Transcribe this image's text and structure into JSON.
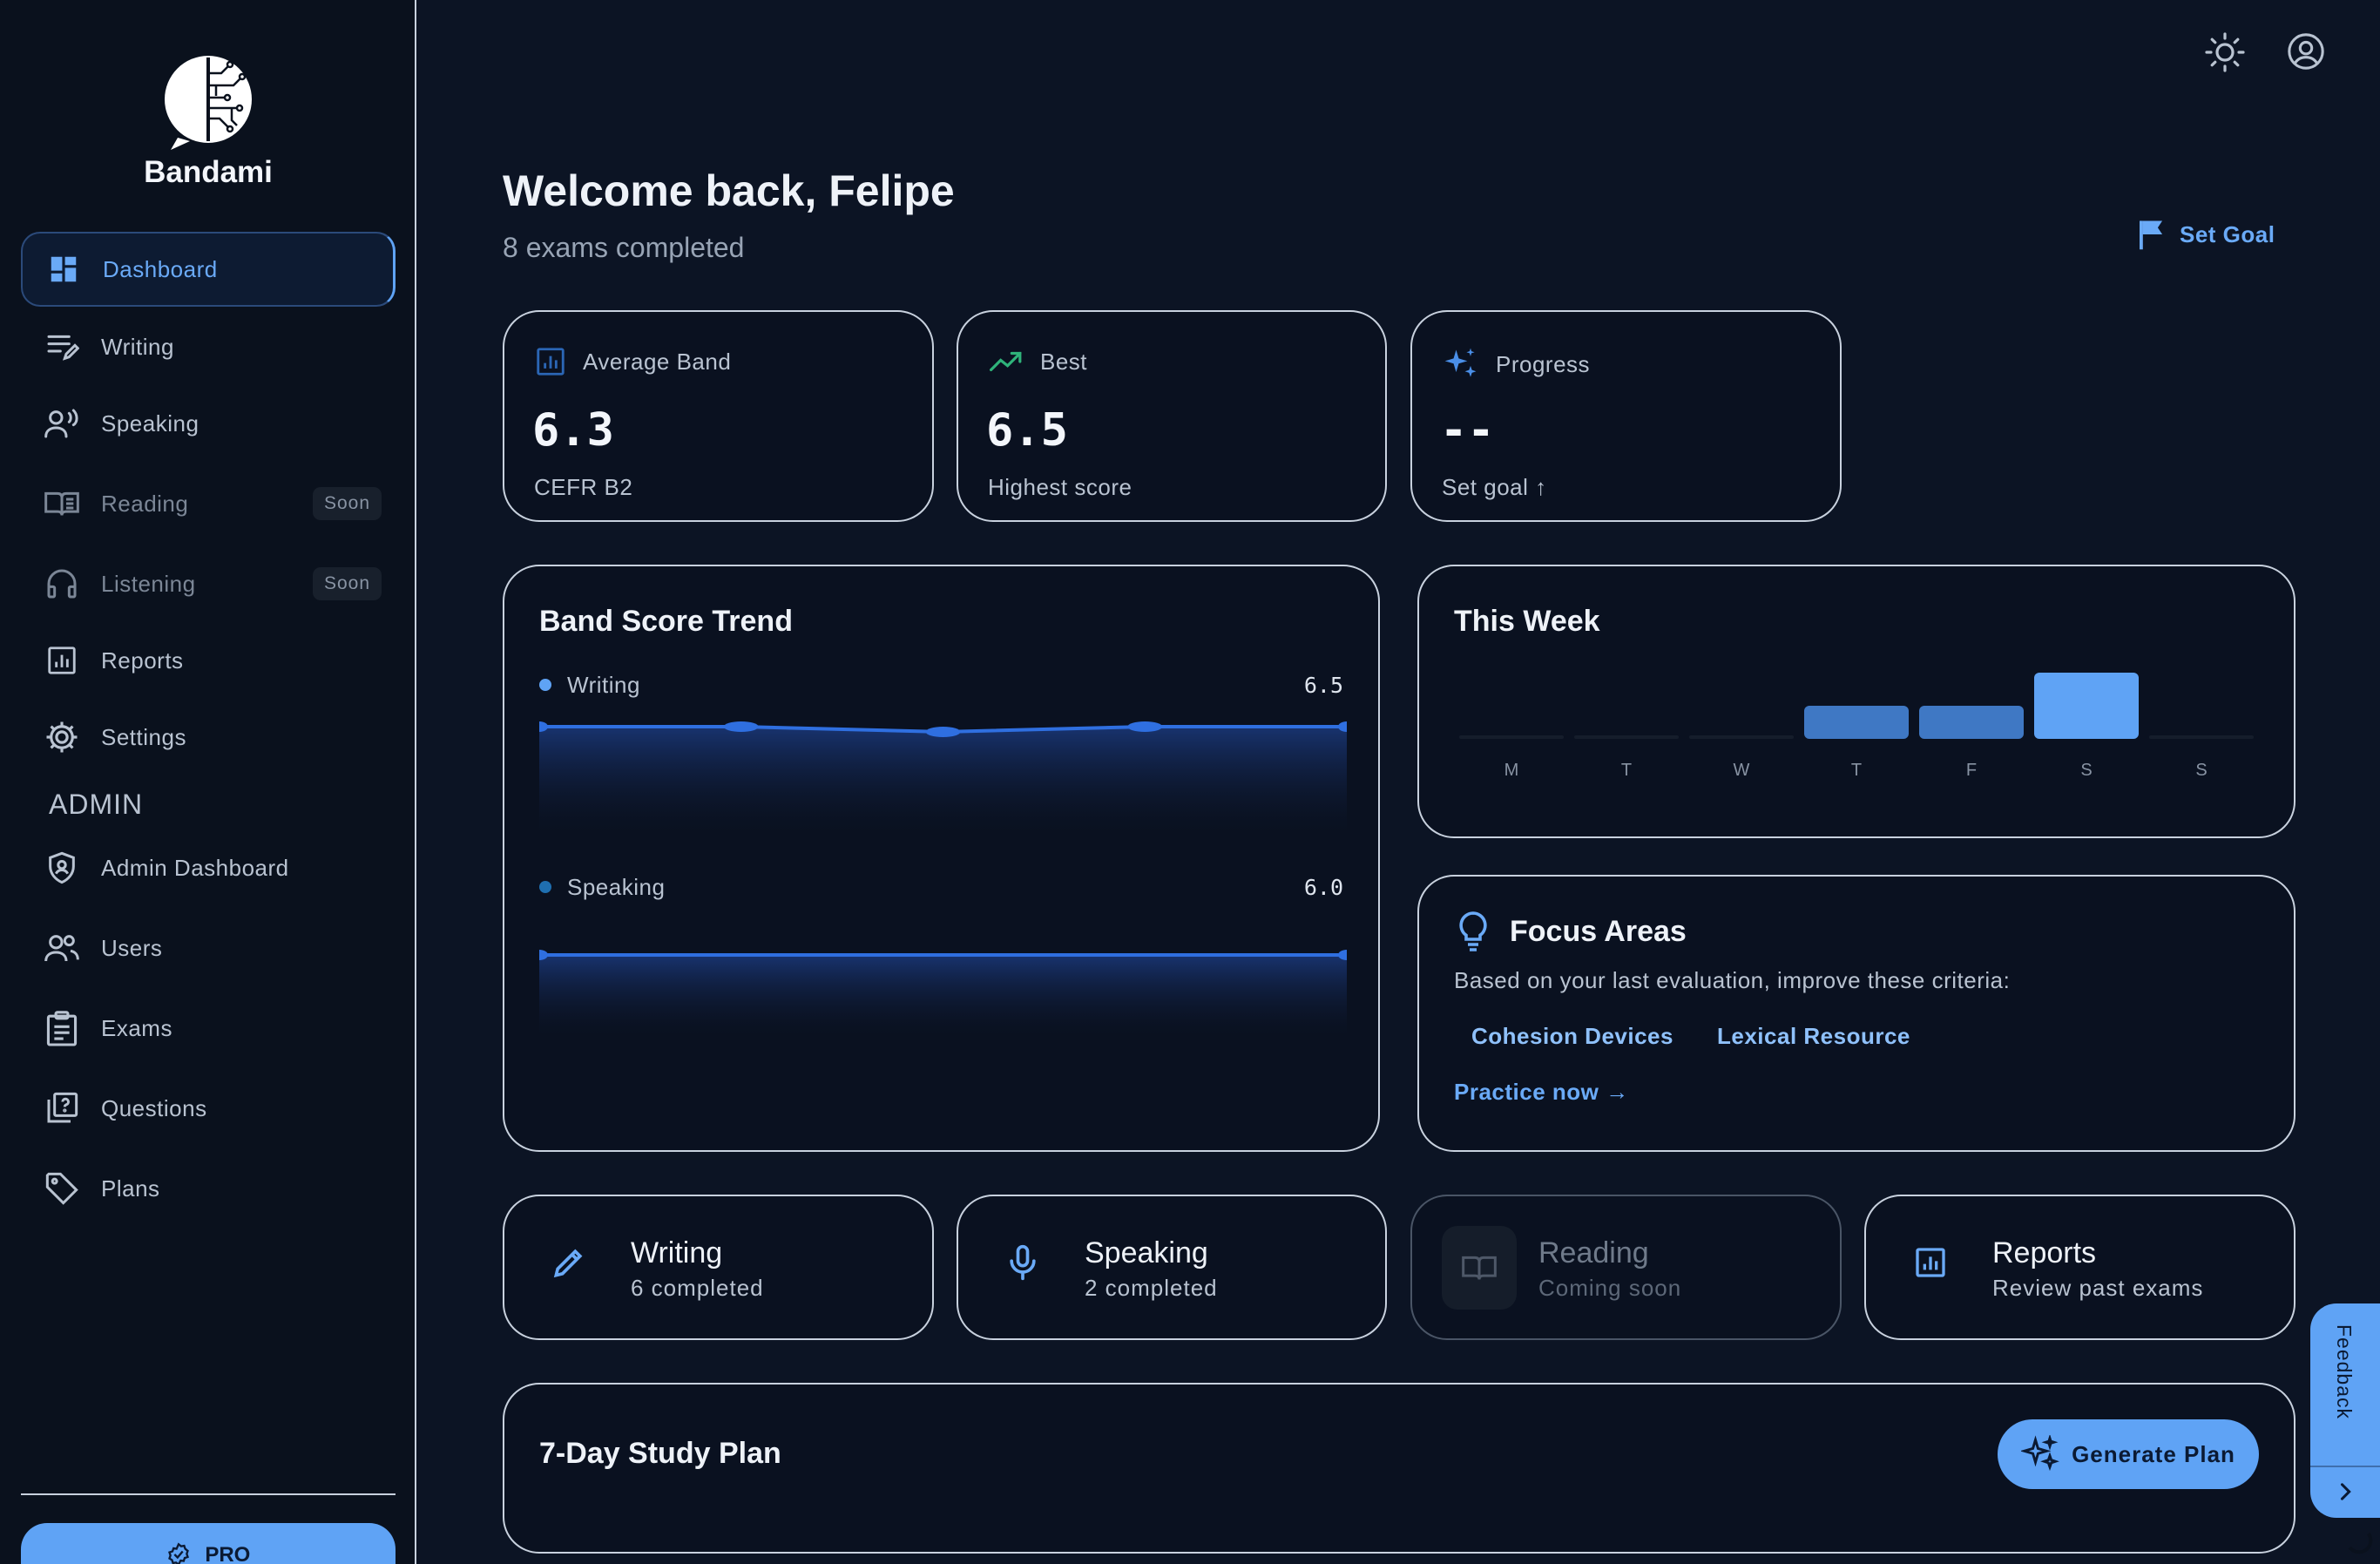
{
  "brand": {
    "name": "Bandami"
  },
  "sidebar": {
    "items": [
      {
        "label": "Dashboard",
        "icon": "dashboard-icon",
        "active": true
      },
      {
        "label": "Writing",
        "icon": "writing-icon"
      },
      {
        "label": "Speaking",
        "icon": "speaking-icon"
      },
      {
        "label": "Reading",
        "icon": "book-icon",
        "badge": "Soon"
      },
      {
        "label": "Listening",
        "icon": "headphones-icon",
        "badge": "Soon"
      },
      {
        "label": "Reports",
        "icon": "reports-icon"
      },
      {
        "label": "Settings",
        "icon": "gear-icon"
      }
    ],
    "admin_heading": "ADMIN",
    "admin_items": [
      {
        "label": "Admin Dashboard",
        "icon": "shield-icon"
      },
      {
        "label": "Users",
        "icon": "users-icon"
      },
      {
        "label": "Exams",
        "icon": "clipboard-icon"
      },
      {
        "label": "Questions",
        "icon": "question-icon"
      },
      {
        "label": "Plans",
        "icon": "tag-icon"
      }
    ],
    "pro_label": "PRO"
  },
  "header": {
    "title": "Welcome back, Felipe",
    "subtitle": "8 exams completed",
    "set_goal": "Set Goal"
  },
  "stats": [
    {
      "label": "Average Band",
      "value": "6.3",
      "sub": "CEFR B2",
      "icon": "chart-icon"
    },
    {
      "label": "Best",
      "value": "6.5",
      "sub": "Highest score",
      "icon": "trending-up-icon"
    },
    {
      "label": "Progress",
      "value": "--",
      "sub": "Set goal ↑",
      "icon": "sparkle-icon"
    }
  ],
  "trend": {
    "title": "Band Score Trend",
    "series": [
      {
        "name": "Writing",
        "latest": "6.5",
        "color": "#5fa3f5"
      },
      {
        "name": "Speaking",
        "latest": "6.0",
        "color": "#1f6fb0"
      }
    ]
  },
  "chart_data": [
    {
      "type": "area",
      "title": "Band Score Trend",
      "series": [
        {
          "name": "Writing",
          "values": [
            6.5,
            6.5,
            6.4,
            6.5,
            6.5
          ]
        },
        {
          "name": "Speaking",
          "values": [
            6.0,
            6.0
          ]
        }
      ]
    },
    {
      "type": "bar",
      "title": "This Week",
      "categories": [
        "M",
        "T",
        "W",
        "T",
        "F",
        "S",
        "S"
      ],
      "values": [
        0,
        0,
        0,
        1,
        1,
        2,
        0
      ]
    }
  ],
  "week": {
    "title": "This Week"
  },
  "focus": {
    "title": "Focus Areas",
    "subtitle": "Based on your last evaluation, improve these criteria:",
    "chips": [
      "Cohesion Devices",
      "Lexical Resource"
    ],
    "practice": "Practice now →"
  },
  "actions": [
    {
      "title": "Writing",
      "sub": "6 completed",
      "icon": "pencil-icon"
    },
    {
      "title": "Speaking",
      "sub": "2 completed",
      "icon": "microphone-icon"
    },
    {
      "title": "Reading",
      "sub": "Coming soon",
      "icon": "book-icon",
      "disabled": true
    },
    {
      "title": "Reports",
      "sub": "Review past exams",
      "icon": "reports-icon"
    }
  ],
  "study_plan": {
    "title": "7-Day Study Plan",
    "button": "Generate Plan"
  },
  "feedback": {
    "label": "Feedback"
  },
  "colors": {
    "accent": "#5fa3f5",
    "background": "#0c1424",
    "success": "#2fb37a"
  }
}
